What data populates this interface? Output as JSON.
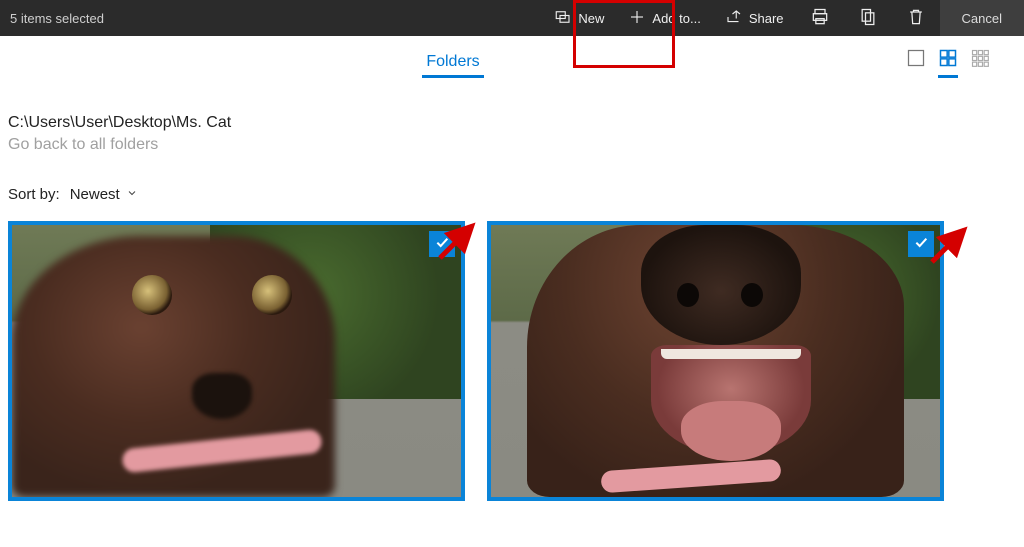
{
  "toolbar": {
    "selection_text": "5 items selected",
    "new_label": "New",
    "add_to_label": "Add to...",
    "share_label": "Share",
    "cancel_label": "Cancel"
  },
  "tabs": {
    "active_tab": "Folders"
  },
  "path": {
    "current": "C:\\Users\\User\\Desktop\\Ms. Cat",
    "back_link": "Go back to all folders"
  },
  "sort": {
    "label": "Sort by:",
    "value": "Newest"
  },
  "colors": {
    "accent": "#0078d4",
    "selection": "#0a84d8",
    "annotation": "#d40000"
  }
}
